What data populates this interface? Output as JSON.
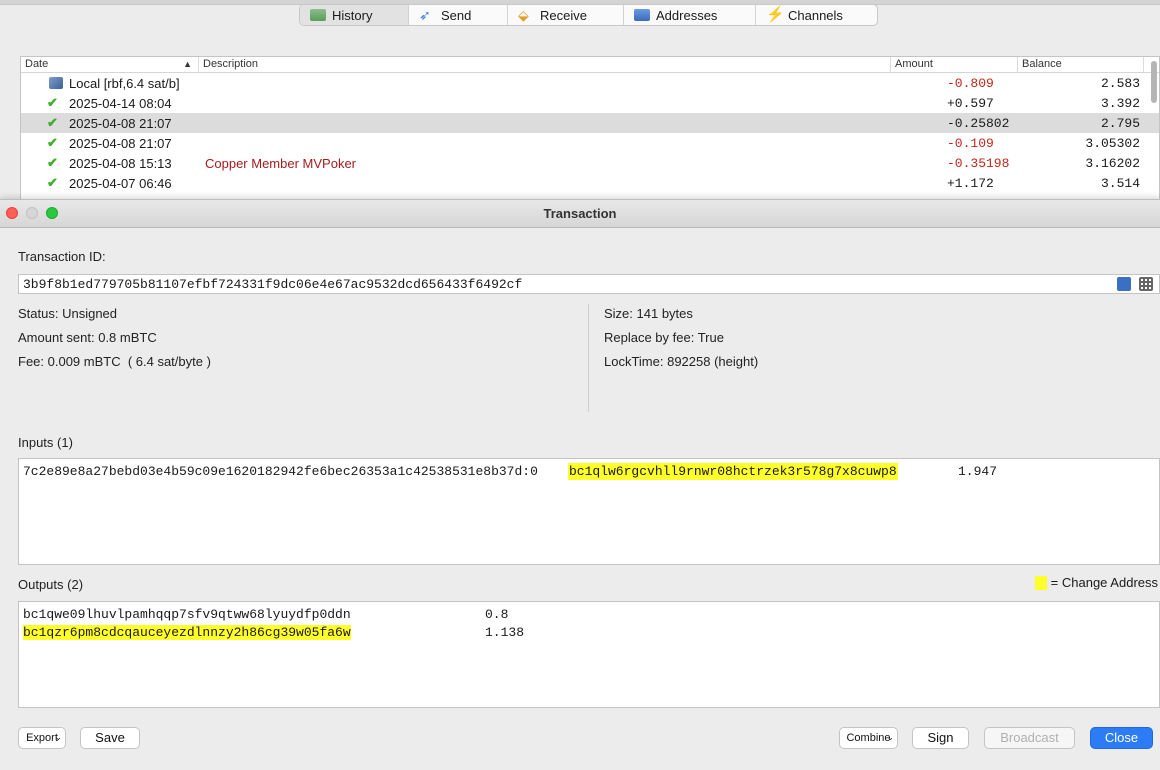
{
  "tabs": [
    {
      "label": "History",
      "icon": "history-icon"
    },
    {
      "label": "Send",
      "icon": "send-icon"
    },
    {
      "label": "Receive",
      "icon": "receive-icon"
    },
    {
      "label": "Addresses",
      "icon": "addresses-icon"
    },
    {
      "label": "Channels",
      "icon": "channels-icon"
    }
  ],
  "history": {
    "columns": {
      "date": "Date",
      "description": "Description",
      "amount": "Amount",
      "balance": "Balance"
    },
    "rows": [
      {
        "date": "Local [rbf,6.4 sat/b]",
        "description": "",
        "amount": "-0.809",
        "balance": "2.583"
      },
      {
        "date": "2025-04-14 08:04",
        "description": "",
        "amount": "+0.597",
        "balance": "3.392"
      },
      {
        "date": "2025-04-08 21:07",
        "description": "",
        "amount": "-0.25802",
        "balance": "2.795"
      },
      {
        "date": "2025-04-08 21:07",
        "description": "",
        "amount": "-0.109",
        "balance": "3.05302"
      },
      {
        "date": "2025-04-08 15:13",
        "description": "Copper Member MVPoker",
        "amount": "-0.35198",
        "balance": "3.16202"
      },
      {
        "date": "2025-04-07 06:46",
        "description": "",
        "amount": "+1.172",
        "balance": "3.514"
      }
    ]
  },
  "dialog": {
    "title": "Transaction",
    "txid_label": "Transaction ID:",
    "txid": "3b9f8b1ed779705b81107efbf724331f9dc06e4e67ac9532dcd656433f6492cf",
    "status": "Status: Unsigned",
    "amount_sent": "Amount sent: 0.8 mBTC",
    "fee": "Fee: 0.009 mBTC  ( 6.4 sat/byte )",
    "size": "Size: 141 bytes",
    "rbf": "Replace by fee: True",
    "locktime": "LockTime: 892258 (height)",
    "inputs_label": "Inputs (1)",
    "inputs": [
      {
        "prevout": "7c2e89e8a27bebd03e4b59c09e1620182942fe6bec26353a1c42538531e8b37d:0",
        "address": "bc1qlw6rgcvhll9rnwr08hctrzek3r578g7x8cuwp8",
        "amount": "1.947"
      }
    ],
    "outputs_label": "Outputs (2)",
    "legend_label": "= Change Address",
    "outputs": [
      {
        "address": "bc1qwe09lhuvlpamhqqp7sfv9qtww68lyuydfp0ddn",
        "amount": "0.8"
      },
      {
        "address": "bc1qzr6pm8cdcqauceyezdlnnzy2h86cg39w05fa6w",
        "amount": "1.138"
      }
    ],
    "buttons": {
      "export": "Export",
      "save": "Save",
      "combine": "Combine",
      "sign": "Sign",
      "broadcast": "Broadcast",
      "close": "Close"
    }
  },
  "colors": {
    "change_highlight": "#ffff2a",
    "negative_amount": "#c0261c",
    "primary_button": "#2b7cf6"
  }
}
